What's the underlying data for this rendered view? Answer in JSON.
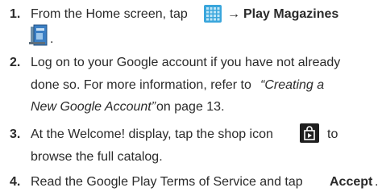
{
  "steps": [
    {
      "number": "1.",
      "lines": [
        {
          "parts": [
            "From the Home screen, tap",
            "→",
            "Play Magazines"
          ]
        },
        {
          "parts": [
            "."
          ]
        }
      ]
    },
    {
      "number": "2.",
      "lines": [
        {
          "parts": [
            "Log on to your Google account if you have not already"
          ]
        },
        {
          "parts": [
            "done so. For more information, refer to",
            "“Creating a"
          ]
        },
        {
          "parts": [
            "New Google Account”",
            "on page 13."
          ]
        }
      ]
    },
    {
      "number": "3.",
      "lines": [
        {
          "parts": [
            "At the Welcome! display, tap the shop icon",
            "to"
          ]
        },
        {
          "parts": [
            "browse the full catalog."
          ]
        }
      ]
    },
    {
      "number": "4.",
      "lines": [
        {
          "parts": [
            "Read the Google Play Terms of Service and tap",
            "Accept",
            "."
          ]
        }
      ]
    }
  ],
  "icons": {
    "apps": "apps-grid-icon",
    "magazines": "play-magazines-icon",
    "shop": "shop-bag-icon"
  },
  "colors": {
    "apps_icon": "#2f9fd6",
    "shop_icon": "#1a1a1a",
    "magazines_icon": "#3b7fc4"
  }
}
